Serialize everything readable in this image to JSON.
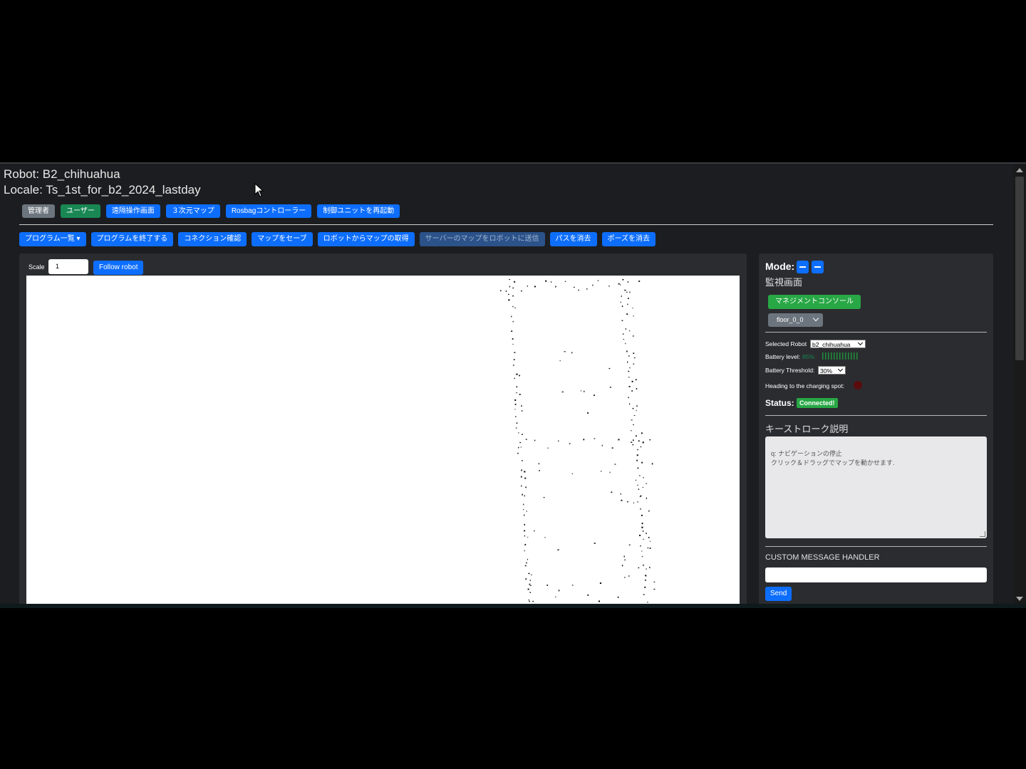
{
  "header": {
    "robot_line": "Robot: B2_chihuahua",
    "locale_line": "Locale: Ts_1st_for_b2_2024_lastday"
  },
  "nav_buttons": [
    {
      "label": "管理者",
      "color": "#6c757d"
    },
    {
      "label": "ユーザー",
      "color": "#198754"
    },
    {
      "label": "遠隔操作画面",
      "color": "#0d6efd"
    },
    {
      "label": "３次元マップ",
      "color": "#0d6efd"
    },
    {
      "label": "Rosbagコントローラー",
      "color": "#0d6efd"
    },
    {
      "label": "制御ユニットを再起動",
      "color": "#0d6efd"
    }
  ],
  "action_buttons": [
    {
      "label": "プログラム一覧 ▾"
    },
    {
      "label": "プログラムを終了する"
    },
    {
      "label": "コネクション確認"
    },
    {
      "label": "マップをセーブ"
    },
    {
      "label": "ロボットからマップの取得"
    },
    {
      "label": "サーバーのマップをロボットに送信",
      "disabled": true
    },
    {
      "label": "パスを消去"
    },
    {
      "label": "ポーズを消去"
    }
  ],
  "map": {
    "scale_label": "Scale",
    "scale_value": "1",
    "follow_label": "Follow robot"
  },
  "side": {
    "mode_label": "Mode:",
    "screen_title": "監視画面",
    "management_button": "マネジメントコンソール",
    "floor_value": "floor_0_0",
    "selected_robot_label": "Selected Robot",
    "selected_robot_value": "b2_chihuahua",
    "battery_label": "Battery level:",
    "battery_value": "85%",
    "threshold_label": "Battery Threshold:",
    "threshold_value": "30%",
    "heading_label": "Heading to the charging spot:",
    "status_label": "Status:",
    "status_value": "Connected!",
    "keystroke_title": "キーストローク説明",
    "keystroke_text": "q: ナビゲーションの停止\nクリック＆ドラッグでマップを動かせます.",
    "custom_handler_title": "CUSTOM MESSAGE HANDLER",
    "send_label": "Send"
  },
  "colors": {
    "primary": "#0d6efd",
    "success": "#28a745",
    "panel": "#2b2c30",
    "background": "#1c1d20"
  }
}
